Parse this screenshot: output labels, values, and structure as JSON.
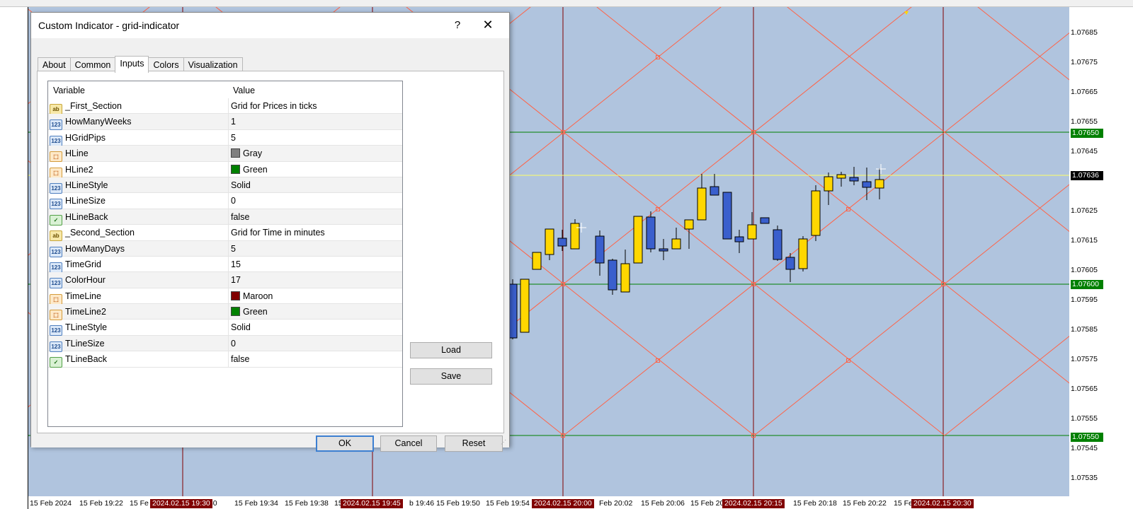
{
  "dialog": {
    "title": "Custom Indicator - grid-indicator",
    "help": "?",
    "close": "✕",
    "tabs": [
      "About",
      "Common",
      "Inputs",
      "Colors",
      "Visualization"
    ],
    "active_tab": "Inputs",
    "columns": [
      "Variable",
      "Value"
    ],
    "rows": [
      {
        "icon": "ab",
        "variable": "_First_Section",
        "value": "Grid for Prices in ticks"
      },
      {
        "icon": "num",
        "variable": "HowManyWeeks",
        "value": "1"
      },
      {
        "icon": "num",
        "variable": "HGridPips",
        "value": "5"
      },
      {
        "icon": "clr",
        "variable": "HLine",
        "value": "Gray",
        "swatch": "#808080"
      },
      {
        "icon": "clr",
        "variable": "HLine2",
        "value": "Green",
        "swatch": "#008000"
      },
      {
        "icon": "num",
        "variable": "HLineStyle",
        "value": "Solid"
      },
      {
        "icon": "num",
        "variable": "HLineSize",
        "value": "0"
      },
      {
        "icon": "bool",
        "variable": "HLineBack",
        "value": "false"
      },
      {
        "icon": "ab",
        "variable": "_Second_Section",
        "value": "Grid for Time in minutes"
      },
      {
        "icon": "num",
        "variable": "HowManyDays",
        "value": "5"
      },
      {
        "icon": "num",
        "variable": "TimeGrid",
        "value": "15"
      },
      {
        "icon": "num",
        "variable": "ColorHour",
        "value": "17"
      },
      {
        "icon": "clr",
        "variable": "TimeLine",
        "value": "Maroon",
        "swatch": "#800000"
      },
      {
        "icon": "clr",
        "variable": "TimeLine2",
        "value": "Green",
        "swatch": "#008000"
      },
      {
        "icon": "num",
        "variable": "TLineStyle",
        "value": "Solid"
      },
      {
        "icon": "num",
        "variable": "TLineSize",
        "value": "0"
      },
      {
        "icon": "bool",
        "variable": "TLineBack",
        "value": "false"
      }
    ],
    "buttons": {
      "load": "Load",
      "save": "Save",
      "ok": "OK",
      "cancel": "Cancel",
      "reset": "Reset"
    }
  },
  "chart": {
    "background": "#b0c4de",
    "up_color": "#ffd700",
    "down_color": "#3a5fcd",
    "grid_h_color": "#008000",
    "grid_v_color": "#800000",
    "diag_color": "#ff6347",
    "bid_line_color": "#ffff66",
    "price_labels": [
      "1.07685",
      "1.07675",
      "1.07665",
      "1.07655",
      "1.07645",
      "1.07625",
      "1.07615",
      "1.07605",
      "1.07595",
      "1.07585",
      "1.07575",
      "1.07565",
      "1.07555",
      "1.07545",
      "1.07535"
    ],
    "price_tags": [
      {
        "text": "1.07650",
        "bg": "#008000"
      },
      {
        "text": "1.07636",
        "bg": "#000000"
      },
      {
        "text": "1.07600",
        "bg": "#008000"
      },
      {
        "text": "1.07550",
        "bg": "#008000"
      }
    ],
    "time_labels": [
      "15 Feb 2024",
      "15 Feb 19:22",
      "15 Fe",
      ":30",
      "15 Feb 19:34",
      "15 Feb 19:38",
      "15",
      "b 19:46",
      "15 Feb 19:50",
      "15 Feb 19:54",
      "Feb 20:02",
      "15 Feb 20:06",
      "15 Feb 20",
      "15 Feb 20:18",
      "15 Feb 20:22",
      "15 Fe"
    ],
    "time_tags": [
      "2024.02.15 19:30",
      "2024.02.15 19:45",
      "2024.02.15 20:00",
      "2024.02.15 20:15",
      "2024.02.15 20:30"
    ]
  }
}
